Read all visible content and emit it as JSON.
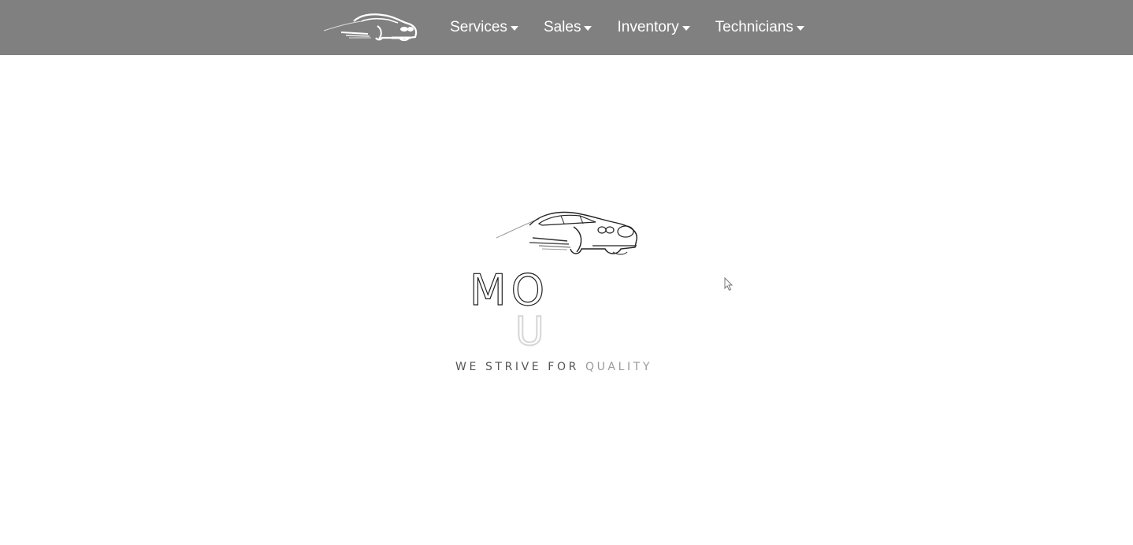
{
  "navbar": {
    "logo_icon": "car-logo-icon",
    "items": [
      {
        "label": "Services"
      },
      {
        "label": "Sales"
      },
      {
        "label": "Inventory"
      },
      {
        "label": "Technicians"
      }
    ]
  },
  "hero": {
    "logo_icon": "car-logo-icon",
    "logo_text_top": "MO",
    "logo_text_bottom": "U",
    "tagline_main": "WE STRIVE FOR ",
    "tagline_accent": "QUALITY"
  },
  "colors": {
    "navbar_bg": "#808080",
    "nav_text": "#ffffff",
    "page_bg": "#ffffff"
  }
}
